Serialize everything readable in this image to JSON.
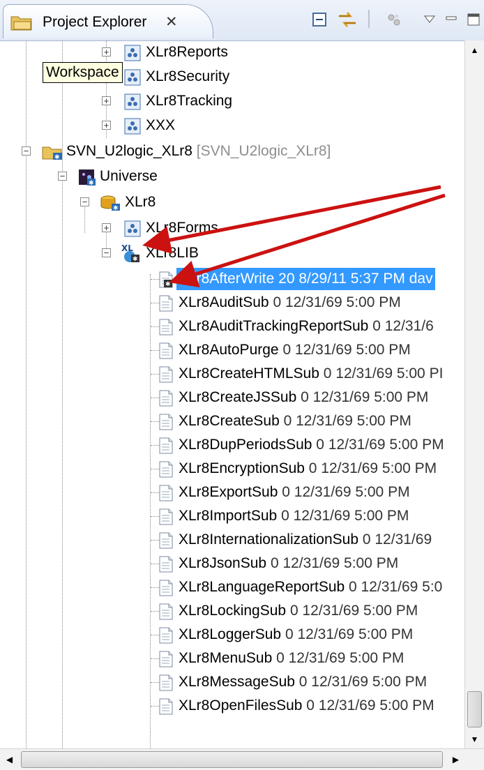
{
  "view": {
    "title": "Project Explorer",
    "close_glyph": "✕",
    "tooltip": "Workspace"
  },
  "toolbar": {
    "buttons": [
      {
        "name": "collapse-all-icon",
        "label": "Collapse All"
      },
      {
        "name": "link-with-editor-icon",
        "label": "Link with Editor"
      },
      {
        "name": "connect-icon",
        "label": "Connect"
      },
      {
        "name": "view-menu-icon",
        "label": "View Menu"
      },
      {
        "name": "minimize-icon",
        "label": "Minimize"
      },
      {
        "name": "maximize-icon",
        "label": "Maximize"
      }
    ]
  },
  "tree": {
    "accounts": [
      "XLr8Reports",
      "XLr8Security",
      "XLr8Tracking",
      "XXX"
    ],
    "project": {
      "name": "SVN_U2logic_XLr8",
      "annotation": "[SVN_U2logic_XLr8]"
    },
    "universe": "Universe",
    "account": "XLr8",
    "forms": "XLr8Forms",
    "lib": "XLr8LIB",
    "files": [
      {
        "name": "XLr8AfterWrite",
        "meta": "20  8/29/11 5:37 PM  dav",
        "selected": true
      },
      {
        "name": "XLr8AuditSub",
        "meta": "0  12/31/69 5:00 PM"
      },
      {
        "name": "XLr8AuditTrackingReportSub",
        "meta": "0  12/31/6"
      },
      {
        "name": "XLr8AutoPurge",
        "meta": "0  12/31/69 5:00 PM"
      },
      {
        "name": "XLr8CreateHTMLSub",
        "meta": "0  12/31/69 5:00 PI"
      },
      {
        "name": "XLr8CreateJSSub",
        "meta": "0  12/31/69 5:00 PM"
      },
      {
        "name": "XLr8CreateSub",
        "meta": "0  12/31/69 5:00 PM"
      },
      {
        "name": "XLr8DupPeriodsSub",
        "meta": "0  12/31/69 5:00 PM"
      },
      {
        "name": "XLr8EncryptionSub",
        "meta": "0  12/31/69 5:00 PM"
      },
      {
        "name": "XLr8ExportSub",
        "meta": "0  12/31/69 5:00 PM"
      },
      {
        "name": "XLr8ImportSub",
        "meta": "0  12/31/69 5:00 PM"
      },
      {
        "name": "XLr8InternationalizationSub",
        "meta": "0  12/31/69"
      },
      {
        "name": "XLr8JsonSub",
        "meta": "0  12/31/69 5:00 PM"
      },
      {
        "name": "XLr8LanguageReportSub",
        "meta": "0  12/31/69 5:0"
      },
      {
        "name": "XLr8LockingSub",
        "meta": "0  12/31/69 5:00 PM"
      },
      {
        "name": "XLr8LoggerSub",
        "meta": "0  12/31/69 5:00 PM"
      },
      {
        "name": "XLr8MenuSub",
        "meta": "0  12/31/69 5:00 PM"
      },
      {
        "name": "XLr8MessageSub",
        "meta": "0  12/31/69 5:00 PM"
      },
      {
        "name": "XLr8OpenFilesSub",
        "meta": "0  12/31/69 5:00 PM"
      }
    ]
  },
  "colors": {
    "selection": "#3399ff",
    "annotation": "#8e8e8e",
    "arrow": "#cc1111",
    "tooltip_bg": "#ffffe1"
  },
  "scrollbars": {
    "up": "▲",
    "down": "▼",
    "left": "◀",
    "right": "▶"
  }
}
